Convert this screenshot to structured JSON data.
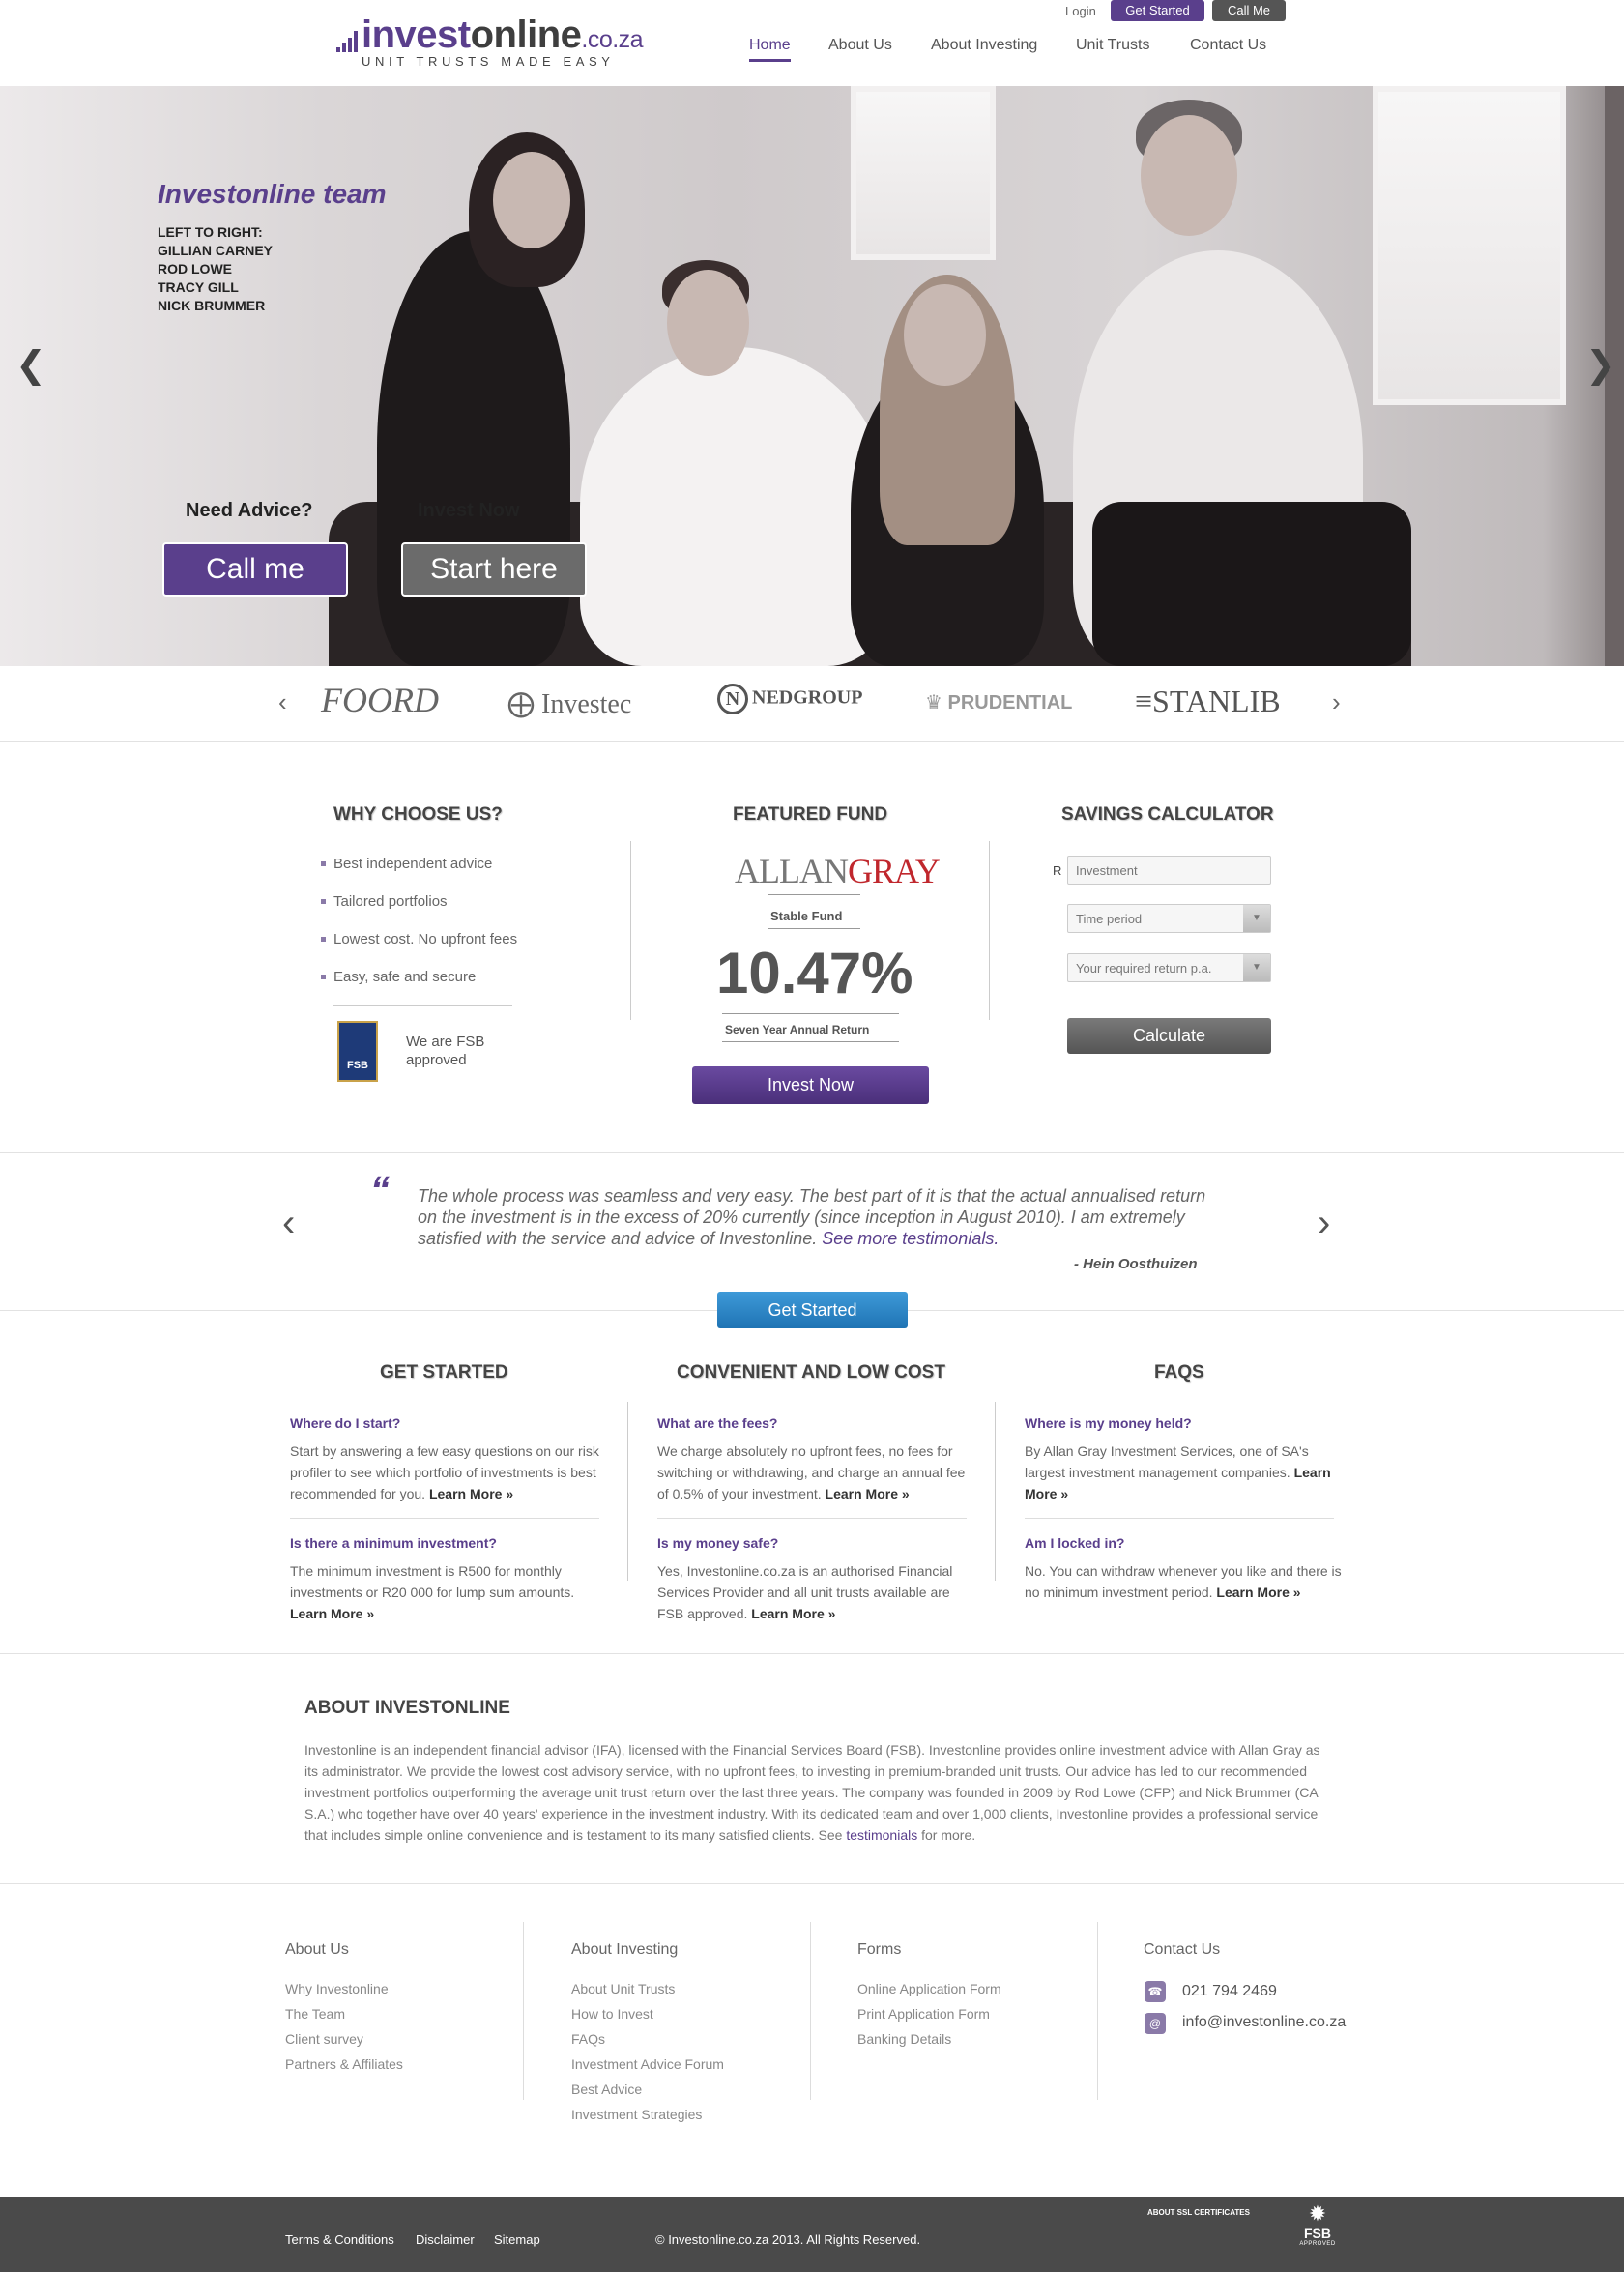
{
  "header": {
    "logo": {
      "part1": "invest",
      "part2": "online",
      "part3": ".co.za",
      "tagline": "UNIT TRUSTS MADE EASY"
    },
    "login_label": "Login",
    "get_started_label": "Get Started",
    "call_me_label": "Call Me",
    "nav": [
      {
        "label": "Home"
      },
      {
        "label": "About Us"
      },
      {
        "label": "About Investing"
      },
      {
        "label": "Unit Trusts"
      },
      {
        "label": "Contact Us"
      }
    ]
  },
  "hero": {
    "title": "Investonline team",
    "caption": "LEFT TO RIGHT:\nGILLIAN CARNEY\nROD LOWE\nTRACY GILL\nNICK BRUMMER",
    "need_advice": "Need Advice?",
    "invest_now": "Invest Now",
    "call_me_button": "Call me",
    "start_here_button": "Start here"
  },
  "partners": [
    "FOORD",
    "Investec",
    "NEDGROUP",
    "PRUDENTIAL",
    "STANLIB"
  ],
  "why_choose": {
    "title": "WHY CHOOSE US?",
    "items": [
      "Best independent advice",
      "Tailored portfolios",
      "Lowest cost. No upfront fees",
      "Easy, safe and secure"
    ],
    "fsb_text": "We are FSB approved",
    "fsb_badge": "FSB"
  },
  "featured_fund": {
    "title": "FEATURED FUND",
    "manager": {
      "part1": "ALLAN",
      "part2": "GRAY"
    },
    "fund_name": "Stable Fund",
    "return_value": "10.47%",
    "return_label": "Seven Year Annual Return",
    "invest_button": "Invest Now"
  },
  "calculator": {
    "title": "SAVINGS CALCULATOR",
    "currency": "R",
    "investment_placeholder": "Investment",
    "time_period": "Time period",
    "required_return": "Your required return p.a.",
    "calculate_button": "Calculate"
  },
  "testimonial": {
    "quote": "The whole process was seamless and very easy. The best part of it is that the actual annualised return on the investment is in the excess of 20% currently (since inception in August 2010). I am extremely satisfied with the service and advice of Investonline.",
    "more_link": "See more testimonials.",
    "author": "- Hein Oosthuizen",
    "get_started_button": "Get Started"
  },
  "faq_columns": [
    {
      "title": "GET STARTED",
      "items": [
        {
          "q": "Where do I start?",
          "a": "Start by answering a few easy questions on our risk profiler to see which portfolio of investments is best recommended for you.",
          "link": "Learn More »"
        },
        {
          "q": "Is there a minimum investment?",
          "a": "The minimum investment is R500 for monthly investments or R20 000 for lump sum amounts.",
          "link": "Learn More »"
        }
      ]
    },
    {
      "title": "CONVENIENT AND LOW COST",
      "items": [
        {
          "q": "What are the fees?",
          "a": "We charge absolutely no upfront fees, no fees for switching or withdrawing, and charge an annual fee of 0.5% of your investment.",
          "link": "Learn More »"
        },
        {
          "q": "Is my money safe?",
          "a": "Yes, Investonline.co.za is an authorised Financial Services Provider and all unit trusts available are FSB approved.",
          "link": "Learn More »"
        }
      ]
    },
    {
      "title": "FAQS",
      "items": [
        {
          "q": "Where is my money held?",
          "a": "By Allan Gray Investment Services, one of SA's largest investment management companies.",
          "link": "Learn More »"
        },
        {
          "q": "Am I locked in?",
          "a": "No. You can withdraw whenever you like and there is no minimum investment period.",
          "link": "Learn More »"
        }
      ]
    }
  ],
  "about": {
    "title": "ABOUT INVESTONLINE",
    "text": "Investonline is an independent financial advisor (IFA), licensed with the Financial Services Board (FSB). Investonline provides online investment advice with Allan Gray as its administrator. We provide the lowest cost advisory service, with no upfront fees, to investing in premium-branded unit trusts. Our advice has led to our recommended investment portfolios outperforming the average unit trust return over the last three years. The company was founded in 2009 by Rod Lowe (CFP) and Nick Brummer (CA S.A.) who together have over 40 years' experience in the investment industry. With its dedicated team and over 1,000 clients, Investonline provides a professional service that includes simple online convenience and is testament to its many satisfied clients. See",
    "link": "testimonials",
    "tail": "for more."
  },
  "footer": {
    "about_us": {
      "title": "About Us",
      "links": [
        "Why Investonline",
        "The Team",
        "Client survey",
        "Partners & Affiliates"
      ]
    },
    "about_investing": {
      "title": "About Investing",
      "links": [
        "About Unit Trusts",
        "How to Invest",
        "FAQs",
        "Investment Advice Forum",
        "Best Advice",
        "Investment Strategies"
      ]
    },
    "forms": {
      "title": "Forms",
      "links": [
        "Online Application Form",
        "Print Application Form",
        "Banking Details"
      ]
    },
    "contact": {
      "title": "Contact Us",
      "phone": "021 794 2469",
      "email": "info@investonline.co.za"
    }
  },
  "bottom_bar": {
    "links": [
      "Terms & Conditions",
      "Disclaimer",
      "Sitemap"
    ],
    "copyright": "© Investonline.co.za 2013. All Rights Reserved.",
    "ssl": "ABOUT SSL CERTIFICATES",
    "fsb": "FSB",
    "fsb_sub": "APPROVED"
  },
  "colors": {
    "brand_purple": "#5a3f8c",
    "button_blue": "#2a85c6",
    "dark_grey": "#4a4a4a"
  }
}
